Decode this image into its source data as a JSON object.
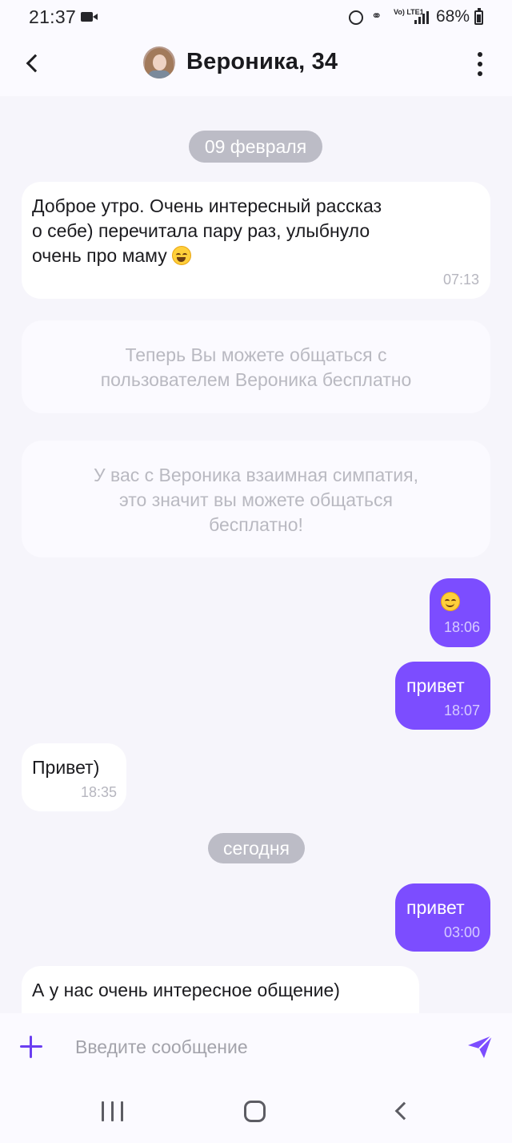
{
  "status_bar": {
    "time": "21:37",
    "battery_percent": "68%",
    "network_label": "Vo) LTE1"
  },
  "header": {
    "back_icon": "chevron-left-icon",
    "title": "Вероника, 34",
    "menu_icon": "kebab-vertical-icon"
  },
  "colors": {
    "accent": "#7c4dff",
    "date_pill": "#bcbcc6",
    "background": "#f6f5fb"
  },
  "messages": [
    {
      "type": "date",
      "text": "09 февраля"
    },
    {
      "type": "received",
      "text": "Доброе утро. Очень интересный рассказ\nо себе) перечитала пару раз, улыбнуло\nочень про маму",
      "emoji": "grinning-squint-icon",
      "time": "07:13"
    },
    {
      "type": "system",
      "text": "Теперь Вы можете общаться с\nпользователем Вероника бесплатно"
    },
    {
      "type": "system",
      "text": "У вас с Вероника взаимная симпатия,\nэто значит вы можете общаться\nбесплатно!"
    },
    {
      "type": "sent",
      "emoji": "smiling-face-icon",
      "time": "18:06"
    },
    {
      "type": "sent",
      "text": "привет",
      "time": "18:07"
    },
    {
      "type": "received",
      "text": "Привет)",
      "time": "18:35"
    },
    {
      "type": "date",
      "text": "сегодня"
    },
    {
      "type": "sent",
      "text": "привет",
      "time": "03:00"
    },
    {
      "type": "received",
      "text": "А у нас очень интересное общение)"
    }
  ],
  "composer": {
    "placeholder": "Введите сообщение",
    "value": "",
    "add_icon": "plus-icon",
    "send_icon": "paper-plane-send-icon"
  },
  "nav_bar": {
    "recent_icon": "recent-apps-icon",
    "home_icon": "home-icon",
    "back_icon": "back-icon"
  }
}
